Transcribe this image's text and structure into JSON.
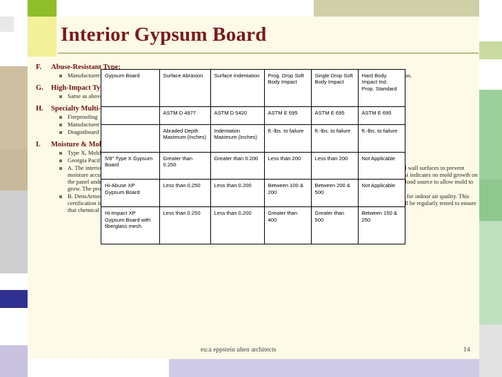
{
  "slide": {
    "title": "Interior Gypsum Board",
    "footer": "eu:a   eppstein uhen architects",
    "page_number": "14"
  },
  "outline": [
    {
      "label": "F.",
      "heading": "Abuse-Resistant Type:",
      "bullets": [
        "Manufacturer: Georgia Pacific DensArmor Plus Abuse-Resistant Interior Panel resists scuffs, scratches, dents, and abrasions in high-traffic areas.",
        ""
      ]
    },
    {
      "label": "G.",
      "heading": "High-Impact Type:",
      "bullets": [
        "Same as above with additional fiberglass mesh embedded in the back of the panel for resistance to through-penetration."
      ]
    },
    {
      "label": "H.",
      "heading": "Specialty Multi-Purpose Types:",
      "bullets": [
        "Fireproofing",
        "Manufacturer",
        "Dragonboard"
      ]
    },
    {
      "label": "I.",
      "heading": "Moisture & Mold-Resistant Types:",
      "bullets": [
        "Type X, Mold and Moisture Resistant Board.  Provide where Mold-Resistant Gypsum Wallboard is noted.",
        "Georgia Pacific DensArmor Plus Interior Panel.",
        "A. The interior environment must be maintained to control the relative humidity, condensation and temperature differential between the air and wall surfaces to prevent moisture accumulation.  The panel has been tested in accordance with ASTM D 3273 and scored a 10, the highest level of performance.  The test indicates no mold growth on the panel under the specific laboratory conditions.  The fiberglass facing and glass mats on the surface are inorganic, which does not provide a food source to allow mold to grow.  The product comes with a 12-month limited warranty against exposure to weather, including doors and windows.",
        "B. DensArmor Plus Interior Panel is GREENGUARD Indoor Air Quality Certified.  Gypsum drywall products to be GREENGUARD certified for indoor air quality.  This certification identifies products that have low emissions of volatile organic compounds (VOCs) for use in indoor spaces.  Certified products will be regularly tested to ensure that chemical and particle emissions meet the GREENGUARD Environmental Institute's emission standards."
      ]
    }
  ],
  "table": {
    "header_main": [
      "Gypsum Board",
      "Surface Abrasion",
      "Surface Indentation",
      "Prog. Drop Soft Body Impact",
      "Single Drop Soft Body Impact",
      "Hard Body Impact Ind. Prop. Standard"
    ],
    "header_std": [
      "",
      "ASTM D 4977",
      "ASTM D 5420",
      "ASTM E 695",
      "ASTM E 695",
      "ASTM E 695"
    ],
    "header_sub": [
      "",
      "Abraded Depth Maximum (Inches)",
      "Indentation Maximum (Inches)",
      "ft.-lbs. to failure",
      "ft.-lbs. to failure",
      "ft.-lbs. to failure"
    ],
    "rows": [
      {
        "product": "5/8\" Type X Gypsum Board",
        "abrasion": "Greater than 0.250",
        "indentation": "Greater than 0.200",
        "prog_drop": "Less than 200",
        "single_drop": "Less than 200",
        "hard_body": "Not Applicable"
      },
      {
        "product": "Hi-Abuse XP Gypsum Board",
        "abrasion": "Less than 0.250",
        "indentation": "Less than 0.200",
        "prog_drop": "Between 100 & 200",
        "single_drop": "Between 200 & 500",
        "hard_body": "Not Applicable"
      },
      {
        "product": "Hi-Impact XP Gypsum Board with fiberglass mesh",
        "abrasion": "Less than 0.250",
        "indentation": "Less than 0.200",
        "prog_drop": "Greater than 400",
        "single_drop": "Greater than 500",
        "hard_body": "Between 150 & 250"
      }
    ]
  }
}
